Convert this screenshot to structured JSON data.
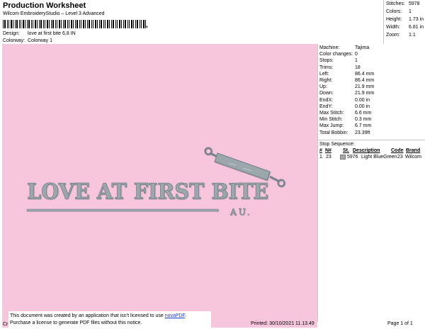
{
  "header": {
    "title": "Production Worksheet",
    "app": "Wilcom EmbroideryStudio – Level 3 Advanced",
    "barcode_suffix": ","
  },
  "design": {
    "label": "Design:",
    "value": "love at first bite 6,8 IN"
  },
  "colorway": {
    "label": "Colorway:",
    "value": "Colorway 1"
  },
  "stats": [
    {
      "label": "Stitches:",
      "value": "5978"
    },
    {
      "label": "Colors:",
      "value": "1"
    },
    {
      "label": "Height:",
      "value": "1.73 in"
    },
    {
      "label": "Width:",
      "value": "6.81 in"
    },
    {
      "label": "Zoom:",
      "value": "1:1"
    }
  ],
  "machine_info": [
    {
      "label": "Machine:",
      "value": "Tajima"
    },
    {
      "label": "Color changes:",
      "value": "0"
    },
    {
      "label": "Stops:",
      "value": "1"
    },
    {
      "label": "Trims:",
      "value": "18"
    },
    {
      "label": "Left:",
      "value": "86.4 mm"
    },
    {
      "label": "Right:",
      "value": "86.4 mm"
    },
    {
      "label": "Up:",
      "value": "21.9 mm"
    },
    {
      "label": "Down:",
      "value": "21.9 mm"
    },
    {
      "label": "EndX:",
      "value": "0.00 in"
    },
    {
      "label": "EndY:",
      "value": "0.00 in"
    },
    {
      "label": "Max Stitch:",
      "value": "6.6 mm"
    },
    {
      "label": "Min Stitch:",
      "value": "0.3 mm"
    },
    {
      "label": "Max Jump:",
      "value": "6.7 mm"
    },
    {
      "label": "Total Bobbin:",
      "value": "23.39ft"
    }
  ],
  "stop_sequence": {
    "title": "Stop Sequence:",
    "headers": {
      "num": "#",
      "n": "N#",
      "st": "St.",
      "description": "Description",
      "code": "Code",
      "brand": "Brand"
    },
    "rows": [
      {
        "num": "1.",
        "n": "23",
        "st": "5976",
        "description": "Light BlueGreen",
        "code": "23",
        "brand": "Wilcom",
        "color": "#a8a8ac"
      }
    ]
  },
  "artwork": {
    "text": "LOVE AT FIRST BITE",
    "subtext": "AU.",
    "thread_color": "#9ba7ad",
    "background": "#f8c6dc"
  },
  "footer": {
    "notice_line1_a": "This document was created by an application that isn’t licensed to use ",
    "notice_link": "novaPDF",
    "notice_line1_b": ".",
    "notice_line2": "Purchase a license to generate PDF files without this notice.",
    "left_stub": "Cr",
    "printed": "Printed: 30/10/2021 11.13.49",
    "page": "Page 1 of 1"
  }
}
